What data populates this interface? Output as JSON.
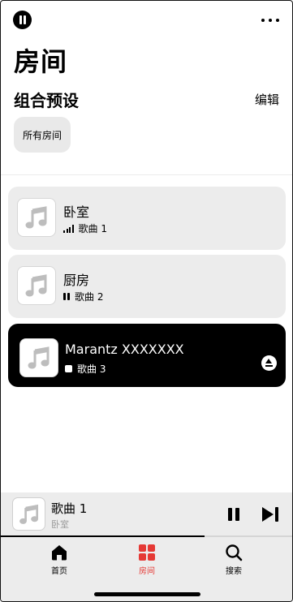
{
  "page": {
    "title": "房间"
  },
  "presets": {
    "section_title": "组合预设",
    "edit_label": "编辑",
    "chip_label": "所有房间"
  },
  "rooms": [
    {
      "name": "卧室",
      "song": "歌曲 1",
      "status": "signal"
    },
    {
      "name": "厨房",
      "song": "歌曲 2",
      "status": "paused"
    },
    {
      "name": "Marantz XXXXXXX",
      "song": "歌曲 3",
      "status": "stopped",
      "selected": true
    }
  ],
  "now_playing": {
    "title": "歌曲 1",
    "room": "卧室",
    "progress": 0.7
  },
  "tabs": [
    {
      "label": "首页",
      "icon": "home-icon"
    },
    {
      "label": "房间",
      "icon": "rooms-icon",
      "active": true
    },
    {
      "label": "搜索",
      "icon": "search-icon"
    }
  ],
  "colors": {
    "accent": "#e53935",
    "card": "#ececec",
    "selected_card": "#000000"
  }
}
